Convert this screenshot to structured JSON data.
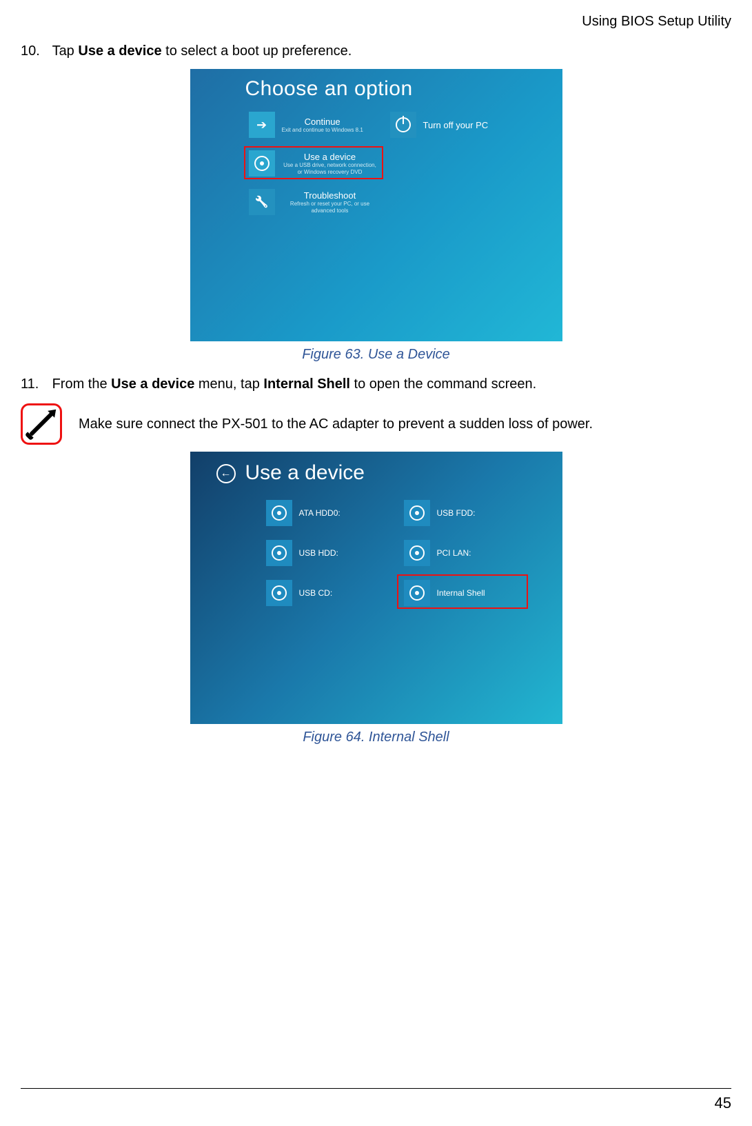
{
  "header": {
    "section": "Using BIOS Setup Utility"
  },
  "steps": {
    "s10": {
      "num": "10.",
      "pre": "Tap ",
      "bold": "Use a device",
      "post": " to select a boot up preference."
    },
    "s11": {
      "num": "11.",
      "pre": "From the ",
      "bold1": "Use a device",
      "mid": " menu, tap ",
      "bold2": "Internal Shell",
      "post": " to open the command screen."
    }
  },
  "captions": {
    "fig63": "Figure 63.  Use a Device",
    "fig64": "Figure 64.  Internal Shell"
  },
  "note": {
    "text": "Make sure connect the PX-501 to the AC adapter to prevent a sudden loss of power."
  },
  "shot1": {
    "title": "Choose an option",
    "continue": {
      "t1": "Continue",
      "t2": "Exit and continue to Windows 8.1"
    },
    "turnoff": {
      "t1": "Turn off your PC"
    },
    "useadevice": {
      "t1": "Use a device",
      "t2": "Use a USB drive, network connection, or Windows recovery DVD"
    },
    "troubleshoot": {
      "t1": "Troubleshoot",
      "t2": "Refresh or reset your PC, or use advanced tools"
    }
  },
  "shot2": {
    "title": "Use a device",
    "back": "←",
    "devices": {
      "atahdd0": "ATA HDD0:",
      "usbhdd": "USB HDD:",
      "usbcd": "USB CD:",
      "usbfdd": "USB FDD:",
      "pcilan": "PCI LAN:",
      "internal": "Internal Shell"
    }
  },
  "footer": {
    "page": "45"
  }
}
